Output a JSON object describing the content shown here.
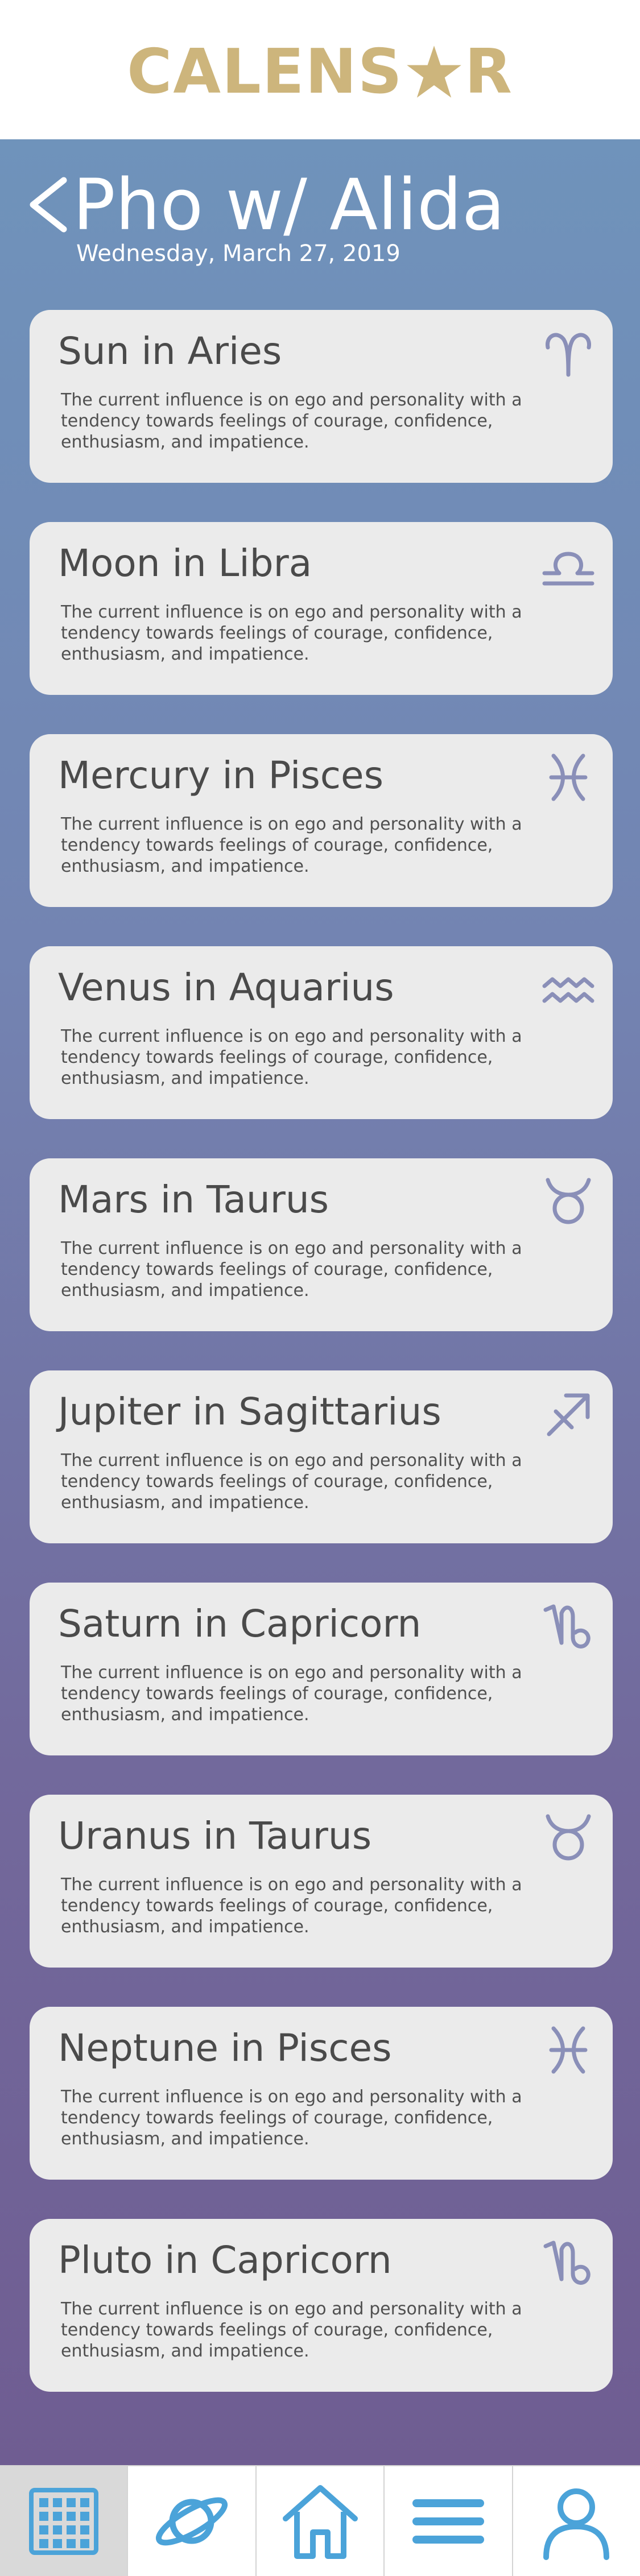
{
  "app": {
    "logo_left": "CALENS",
    "logo_right": "R",
    "brand_color": "#cdb57c"
  },
  "event": {
    "title": "Pho w/ Alida",
    "date": "Wednesday, March 27, 2019"
  },
  "placements": [
    {
      "title": "Sun in Aries",
      "desc": "The current influence is on ego and personality with a tendency towards feelings of courage, confidence, enthusiasm, and impatience.",
      "icon": "aries-icon"
    },
    {
      "title": "Moon in Libra",
      "desc": "The current influence is on ego and personality with a tendency towards feelings of courage, confidence, enthusiasm, and impatience.",
      "icon": "libra-icon"
    },
    {
      "title": "Mercury in Pisces",
      "desc": "The current influence is on ego and personality with a tendency towards feelings of courage, confidence, enthusiasm, and impatience.",
      "icon": "pisces-icon"
    },
    {
      "title": "Venus in Aquarius",
      "desc": "The current influence is on ego and personality with a tendency towards feelings of courage, confidence, enthusiasm, and impatience.",
      "icon": "aquarius-icon"
    },
    {
      "title": "Mars in Taurus",
      "desc": "The current influence is on ego and personality with a tendency towards feelings of courage, confidence, enthusiasm, and impatience.",
      "icon": "taurus-icon"
    },
    {
      "title": "Jupiter in Sagittarius",
      "desc": "The current influence is on ego and personality with a tendency towards feelings of courage, confidence, enthusiasm, and impatience.",
      "icon": "sagittarius-icon"
    },
    {
      "title": "Saturn in Capricorn",
      "desc": "The current influence is on ego and personality with a tendency towards feelings of courage, confidence, enthusiasm, and impatience.",
      "icon": "capricorn-icon"
    },
    {
      "title": "Uranus in Taurus",
      "desc": "The current influence is on ego and personality with a tendency towards feelings of courage, confidence, enthusiasm, and impatience.",
      "icon": "taurus-icon"
    },
    {
      "title": "Neptune in Pisces",
      "desc": "The current influence is on ego and personality with a tendency towards feelings of courage, confidence, enthusiasm, and impatience.",
      "icon": "pisces-icon"
    },
    {
      "title": "Pluto in Capricorn",
      "desc": "The current influence is on ego and personality with a tendency towards feelings of courage, confidence, enthusiasm, and impatience.",
      "icon": "capricorn-icon"
    }
  ],
  "nav": [
    {
      "icon": "calendar-icon",
      "active": true
    },
    {
      "icon": "planet-icon",
      "active": false
    },
    {
      "icon": "home-icon",
      "active": false
    },
    {
      "icon": "menu-icon",
      "active": false
    },
    {
      "icon": "profile-icon",
      "active": false
    }
  ],
  "colors": {
    "icon": "#8a8fb8",
    "nav_icon": "#4ba3d9",
    "card_bg": "#ebebeb"
  }
}
